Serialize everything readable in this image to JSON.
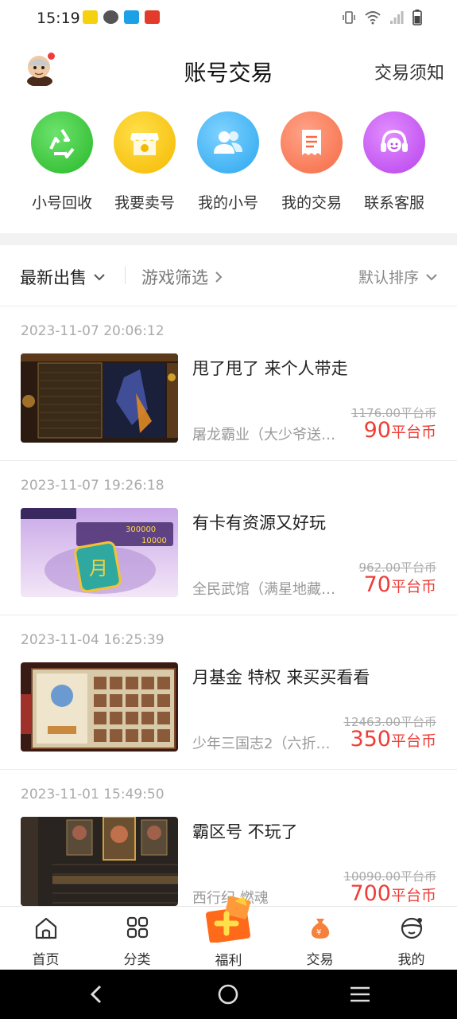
{
  "status_bar": {
    "time": "15:19"
  },
  "header": {
    "title": "账号交易",
    "notice_link": "交易须知"
  },
  "quick_menu": [
    {
      "label": "小号回收",
      "icon": "recycle-icon",
      "color": "#3cc93c"
    },
    {
      "label": "我要卖号",
      "icon": "store-icon",
      "color": "#f7c21b"
    },
    {
      "label": "我的小号",
      "icon": "users-icon",
      "color": "#3fb4f5"
    },
    {
      "label": "我的交易",
      "icon": "receipt-icon",
      "color": "#fb7a58"
    },
    {
      "label": "联系客服",
      "icon": "headset-icon",
      "color": "#c95ef2"
    }
  ],
  "filters": {
    "latest": "最新出售",
    "game_filter": "游戏筛选",
    "sort": "默认排序"
  },
  "listings": [
    {
      "time": "2023-11-07 20:06:12",
      "title": "甩了甩了 来个人带走",
      "game": "屠龙霸业（大少爷送…",
      "original_price": "1176.00平台币",
      "price_value": "90",
      "price_unit": "平台币"
    },
    {
      "time": "2023-11-07 19:26:18",
      "title": "有卡有资源又好玩",
      "game": "全民武馆（满星地藏…",
      "original_price": "962.00平台币",
      "price_value": "70",
      "price_unit": "平台币",
      "thumb_text": "月",
      "thumb_promo_1": "300000",
      "thumb_promo_2": "10000"
    },
    {
      "time": "2023-11-04 16:25:39",
      "title": "月基金 特权  来买买看看",
      "game": "少年三国志2（六折…",
      "original_price": "12463.00平台币",
      "price_value": "350",
      "price_unit": "平台币"
    },
    {
      "time": "2023-11-01 15:49:50",
      "title": "霸区号 不玩了",
      "game": "西行纪 燃魂",
      "original_price": "10090.00平台币",
      "price_value": "700",
      "price_unit": "平台币"
    }
  ],
  "tab_bar": [
    {
      "label": "首页",
      "icon": "home-icon"
    },
    {
      "label": "分类",
      "icon": "category-icon"
    },
    {
      "label": "福利",
      "icon": "gift-icon"
    },
    {
      "label": "交易",
      "icon": "money-bag-icon"
    },
    {
      "label": "我的",
      "icon": "profile-icon"
    }
  ],
  "colors": {
    "accent_red": "#ee3d37",
    "trade_orange": "#f5813c"
  }
}
